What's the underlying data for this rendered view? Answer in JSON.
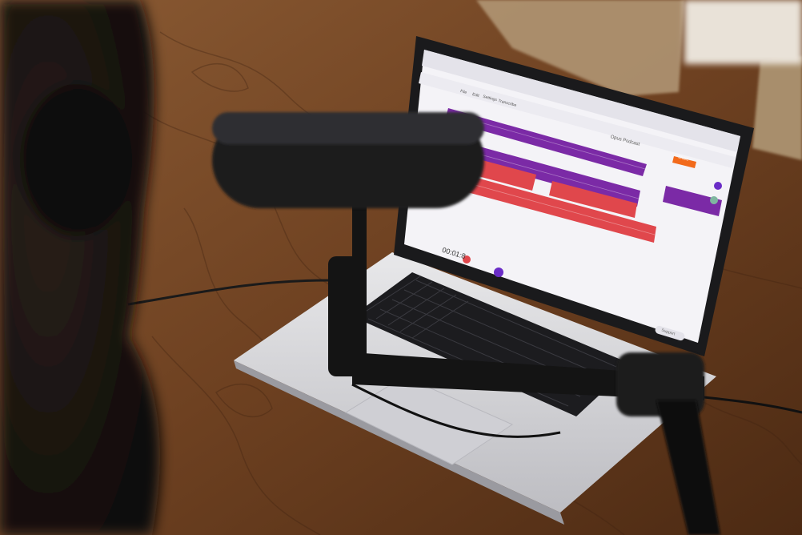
{
  "scene": {
    "description_colors": {
      "table": "#7a4a28",
      "table_dark": "#4a2a14",
      "laptop_body": "#d9d9dc",
      "screen_bg": "#f4f3f7",
      "track_purple": "#7b2aa6",
      "track_red": "#e0474c",
      "accent_orange": "#f26a1b",
      "playhead_purple": "#6a2cc7"
    }
  },
  "screen_ui": {
    "timecode": "00:01:8",
    "menu_items": [
      "File",
      "Edit",
      "Settings",
      "Transcribe"
    ],
    "title": "Opus Podcast",
    "share_button": "Share",
    "support_button": "Support"
  }
}
